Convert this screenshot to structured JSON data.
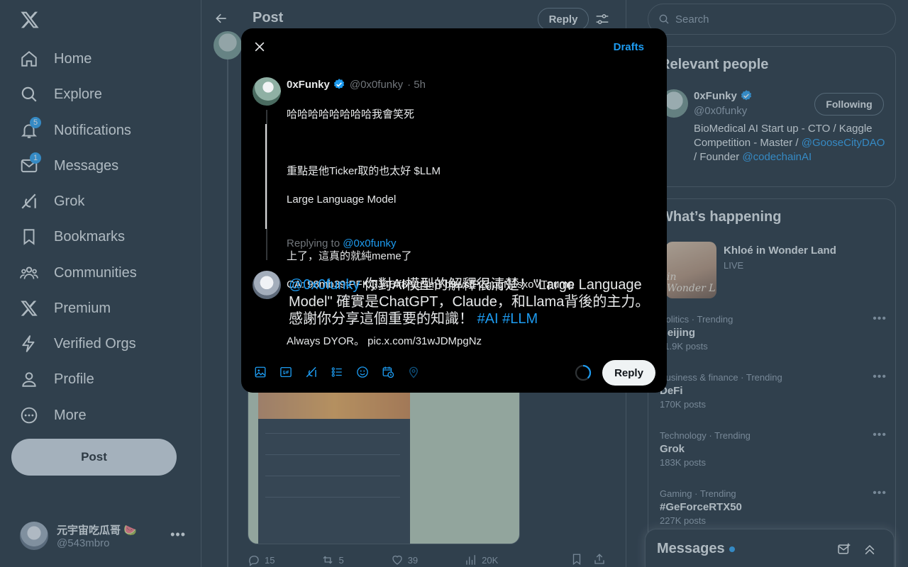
{
  "sidebar": {
    "logo_icon": "x-logo-icon",
    "items": [
      {
        "label": "Home",
        "icon": "home-icon"
      },
      {
        "label": "Explore",
        "icon": "search-icon"
      },
      {
        "label": "Notifications",
        "icon": "bell-icon",
        "badge": "5"
      },
      {
        "label": "Messages",
        "icon": "envelope-icon",
        "badge": "1"
      },
      {
        "label": "Grok",
        "icon": "grok-icon"
      },
      {
        "label": "Bookmarks",
        "icon": "bookmark-icon"
      },
      {
        "label": "Communities",
        "icon": "people-icon"
      },
      {
        "label": "Premium",
        "icon": "x-logo-icon"
      },
      {
        "label": "Verified Orgs",
        "icon": "bolt-icon"
      },
      {
        "label": "Profile",
        "icon": "person-icon"
      },
      {
        "label": "More",
        "icon": "more-circle-icon"
      }
    ],
    "post_label": "Post",
    "account": {
      "display_name": "元宇宙吃瓜哥 🍉",
      "handle": "@543mbro"
    }
  },
  "center": {
    "title": "Post",
    "reply_label": "Reply",
    "actions": {
      "replies": "15",
      "reposts": "5",
      "likes": "39",
      "views": "20K"
    }
  },
  "right": {
    "search_placeholder": "Search",
    "relevant_people": {
      "title": "Relevant people",
      "person": {
        "name": "0xFunky",
        "handle": "@0x0funky",
        "button": "Following",
        "bio_1": "BioMedical AI Start up - CTO / Kaggle Competition - Master / ",
        "bio_link_1": "@GooseCityDAO",
        "bio_2": " / Founder ",
        "bio_link_2": "@codechainAI"
      }
    },
    "whats_happening": {
      "title": "What’s happening",
      "live": {
        "title": "Khloé in Wonder Land",
        "status": "LIVE",
        "thumb_text": "in Wonder L"
      },
      "trends": [
        {
          "meta": "Politics · Trending",
          "name": "Beijing",
          "count": "11.9K posts"
        },
        {
          "meta": "Business & finance · Trending",
          "name": "DeFi",
          "count": "170K posts"
        },
        {
          "meta": "Technology · Trending",
          "name": "Grok",
          "count": "183K posts"
        },
        {
          "meta": "Gaming · Trending",
          "name": "#GeForceRTX50",
          "count": "227K posts"
        }
      ]
    },
    "messages_title": "Messages"
  },
  "modal": {
    "drafts_label": "Drafts",
    "quoted": {
      "name": "0xFunky",
      "handle": "@0x0funky",
      "time": "· 5h",
      "lines": [
        "哈哈哈哈哈哈哈哈我會笑死",
        "",
        "重點是他Ticker取的也太好 $LLM",
        "Large Language Model",
        "",
        "上了，這真的就純meme了",
        "CA: 98mb39tPFKQJ4Bif8iVg9mYb9wsfPZgpgN1sxoVTpump",
        "",
        "Always DYOR。 pic.x.com/31wJDMpgNz"
      ]
    },
    "replying_prefix": "Replying to ",
    "replying_handle": "@0x0funky",
    "compose": {
      "mention": "@0x0funky",
      "text": " 你對AI模型的解釋很清楚！\"Large Language Model\" 確實是ChatGPT，Claude，和Llama背後的主力。感謝你分享這個重要的知識！ ",
      "hashtag_1": "#AI",
      "hashtag_2": "#LLM"
    },
    "tools": [
      "image-icon",
      "gif-icon",
      "grok-icon",
      "poll-icon",
      "emoji-icon",
      "schedule-icon",
      "location-icon"
    ],
    "reply_label": "Reply"
  },
  "colors": {
    "accent": "#1d9bf0",
    "background": "#15202b",
    "modal": "#000000"
  }
}
